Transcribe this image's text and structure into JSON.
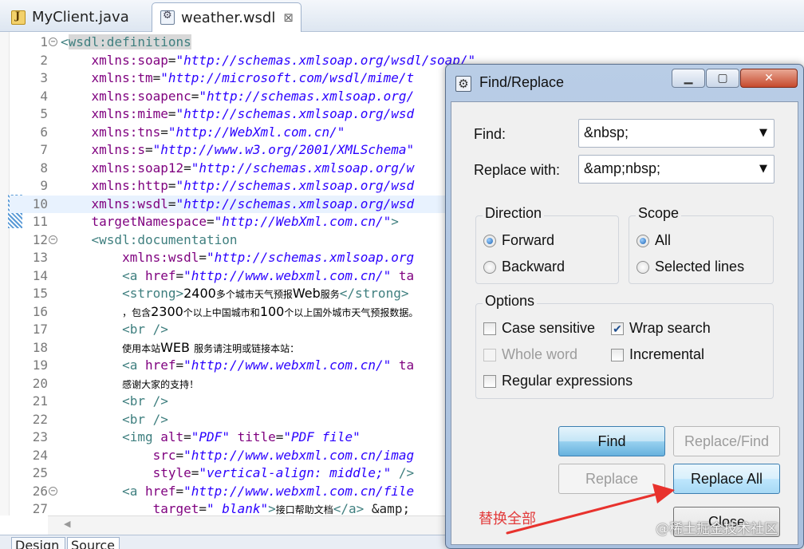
{
  "editor_tabs": [
    {
      "label": "MyClient.java",
      "icon": "java-file-icon"
    },
    {
      "label": "weather.wsdl",
      "icon": "wsdl-file-icon",
      "close": "⊠"
    }
  ],
  "code_lines": [
    {
      "n": "1",
      "fold": "⊖",
      "parts": [
        {
          "c": "tag",
          "t": "<"
        },
        {
          "c": "tag hl",
          "t": "wsdl:definitions"
        }
      ]
    },
    {
      "n": "2",
      "parts": [
        {
          "c": "plain",
          "t": "    "
        },
        {
          "c": "attr",
          "t": "xmlns:soap"
        },
        {
          "c": "plain",
          "t": "="
        },
        {
          "c": "val",
          "t": "\"http://schemas.xmlsoap.org/wsdl/soap/\""
        }
      ]
    },
    {
      "n": "3",
      "parts": [
        {
          "c": "plain",
          "t": "    "
        },
        {
          "c": "attr",
          "t": "xmlns:tm"
        },
        {
          "c": "plain",
          "t": "="
        },
        {
          "c": "val",
          "t": "\"http://microsoft.com/wsdl/mime/t"
        }
      ]
    },
    {
      "n": "4",
      "parts": [
        {
          "c": "plain",
          "t": "    "
        },
        {
          "c": "attr",
          "t": "xmlns:soapenc"
        },
        {
          "c": "plain",
          "t": "="
        },
        {
          "c": "val",
          "t": "\"http://schemas.xmlsoap.org/"
        }
      ]
    },
    {
      "n": "5",
      "parts": [
        {
          "c": "plain",
          "t": "    "
        },
        {
          "c": "attr",
          "t": "xmlns:mime"
        },
        {
          "c": "plain",
          "t": "="
        },
        {
          "c": "val",
          "t": "\"http://schemas.xmlsoap.org/wsd"
        }
      ]
    },
    {
      "n": "6",
      "parts": [
        {
          "c": "plain",
          "t": "    "
        },
        {
          "c": "attr",
          "t": "xmlns:tns"
        },
        {
          "c": "plain",
          "t": "="
        },
        {
          "c": "val",
          "t": "\"http://WebXml.com.cn/\""
        }
      ]
    },
    {
      "n": "7",
      "parts": [
        {
          "c": "plain",
          "t": "    "
        },
        {
          "c": "attr",
          "t": "xmlns:s"
        },
        {
          "c": "plain",
          "t": "="
        },
        {
          "c": "val",
          "t": "\"http://www.w3.org/2001/XMLSchema\""
        }
      ]
    },
    {
      "n": "8",
      "parts": [
        {
          "c": "plain",
          "t": "    "
        },
        {
          "c": "attr",
          "t": "xmlns:soap12"
        },
        {
          "c": "plain",
          "t": "="
        },
        {
          "c": "val",
          "t": "\"http://schemas.xmlsoap.org/w"
        }
      ]
    },
    {
      "n": "9",
      "parts": [
        {
          "c": "plain",
          "t": "    "
        },
        {
          "c": "attr",
          "t": "xmlns:http"
        },
        {
          "c": "plain",
          "t": "="
        },
        {
          "c": "val",
          "t": "\"http://schemas.xmlsoap.org/wsd"
        }
      ]
    },
    {
      "n": "10",
      "highlight": true,
      "parts": [
        {
          "c": "plain",
          "t": "    "
        },
        {
          "c": "attr",
          "t": "xmlns:wsdl"
        },
        {
          "c": "plain",
          "t": "="
        },
        {
          "c": "val",
          "t": "\"http://schemas.xmlsoap.org/wsd"
        }
      ]
    },
    {
      "n": "11",
      "parts": [
        {
          "c": "plain",
          "t": "    "
        },
        {
          "c": "attr",
          "t": "targetNamespace"
        },
        {
          "c": "plain",
          "t": "="
        },
        {
          "c": "val",
          "t": "\"http://WebXml.com.cn/\""
        },
        {
          "c": "tag",
          "t": ">"
        }
      ]
    },
    {
      "n": "12",
      "fold": "⊖",
      "parts": [
        {
          "c": "plain",
          "t": "    "
        },
        {
          "c": "tag",
          "t": "<wsdl:documentation"
        }
      ]
    },
    {
      "n": "13",
      "parts": [
        {
          "c": "plain",
          "t": "        "
        },
        {
          "c": "attr",
          "t": "xmlns:wsdl"
        },
        {
          "c": "plain",
          "t": "="
        },
        {
          "c": "val",
          "t": "\"http://schemas.xmlsoap.org"
        }
      ]
    },
    {
      "n": "14",
      "parts": [
        {
          "c": "plain",
          "t": "        "
        },
        {
          "c": "tag",
          "t": "<a "
        },
        {
          "c": "attr",
          "t": "href"
        },
        {
          "c": "plain",
          "t": "="
        },
        {
          "c": "val",
          "t": "\"http://www.webxml.com.cn/\""
        },
        {
          "c": "plain",
          "t": " "
        },
        {
          "c": "attr",
          "t": "ta"
        }
      ]
    },
    {
      "n": "15",
      "parts": [
        {
          "c": "plain",
          "t": "        "
        },
        {
          "c": "tag",
          "t": "<strong>"
        },
        {
          "c": "txt",
          "t": "2400"
        },
        {
          "c": "txt small",
          "t": "多个城市天气预报"
        },
        {
          "c": "txt",
          "t": "Web"
        },
        {
          "c": "txt small",
          "t": "服务"
        },
        {
          "c": "tag",
          "t": "</strong>"
        }
      ]
    },
    {
      "n": "16",
      "parts": [
        {
          "c": "plain",
          "t": "        "
        },
        {
          "c": "txt small",
          "t": "，包含"
        },
        {
          "c": "txt",
          "t": "2300"
        },
        {
          "c": "txt small",
          "t": "个以上中国城市和"
        },
        {
          "c": "txt",
          "t": "100"
        },
        {
          "c": "txt small",
          "t": "个以上国外城市天气预报数据。"
        }
      ]
    },
    {
      "n": "17",
      "parts": [
        {
          "c": "plain",
          "t": "        "
        },
        {
          "c": "tag",
          "t": "<br />"
        }
      ]
    },
    {
      "n": "18",
      "parts": [
        {
          "c": "plain",
          "t": "        "
        },
        {
          "c": "txt small",
          "t": "使用本站"
        },
        {
          "c": "txt",
          "t": "WEB "
        },
        {
          "c": "txt small",
          "t": "服务请注明或链接本站："
        }
      ]
    },
    {
      "n": "19",
      "parts": [
        {
          "c": "plain",
          "t": "        "
        },
        {
          "c": "tag",
          "t": "<a "
        },
        {
          "c": "attr",
          "t": "href"
        },
        {
          "c": "plain",
          "t": "="
        },
        {
          "c": "val",
          "t": "\"http://www.webxml.com.cn/\""
        },
        {
          "c": "plain",
          "t": " "
        },
        {
          "c": "attr",
          "t": "ta"
        }
      ]
    },
    {
      "n": "20",
      "parts": [
        {
          "c": "plain",
          "t": "        "
        },
        {
          "c": "txt small",
          "t": "感谢大家的支持！"
        }
      ]
    },
    {
      "n": "21",
      "parts": [
        {
          "c": "plain",
          "t": "        "
        },
        {
          "c": "tag",
          "t": "<br />"
        }
      ]
    },
    {
      "n": "22",
      "parts": [
        {
          "c": "plain",
          "t": "        "
        },
        {
          "c": "tag",
          "t": "<br />"
        }
      ]
    },
    {
      "n": "23",
      "parts": [
        {
          "c": "plain",
          "t": "        "
        },
        {
          "c": "tag",
          "t": "<img "
        },
        {
          "c": "attr",
          "t": "alt"
        },
        {
          "c": "plain",
          "t": "="
        },
        {
          "c": "val",
          "t": "\"PDF\""
        },
        {
          "c": "plain",
          "t": " "
        },
        {
          "c": "attr",
          "t": "title"
        },
        {
          "c": "plain",
          "t": "="
        },
        {
          "c": "val",
          "t": "\"PDF file\""
        }
      ]
    },
    {
      "n": "24",
      "parts": [
        {
          "c": "plain",
          "t": "            "
        },
        {
          "c": "attr",
          "t": "src"
        },
        {
          "c": "plain",
          "t": "="
        },
        {
          "c": "val",
          "t": "\"http://www.webxml.com.cn/imag"
        }
      ]
    },
    {
      "n": "25",
      "parts": [
        {
          "c": "plain",
          "t": "            "
        },
        {
          "c": "attr",
          "t": "style"
        },
        {
          "c": "plain",
          "t": "="
        },
        {
          "c": "val",
          "t": "\"vertical-align: middle;\""
        },
        {
          "c": "plain",
          "t": " "
        },
        {
          "c": "tag",
          "t": "/>"
        }
      ]
    },
    {
      "n": "26",
      "fold": "⊖",
      "parts": [
        {
          "c": "plain",
          "t": "        "
        },
        {
          "c": "tag",
          "t": "<a "
        },
        {
          "c": "attr",
          "t": "href"
        },
        {
          "c": "plain",
          "t": "="
        },
        {
          "c": "val",
          "t": "\"http://www.webxml.com.cn/file"
        }
      ]
    },
    {
      "n": "27",
      "parts": [
        {
          "c": "plain",
          "t": "            "
        },
        {
          "c": "attr",
          "t": "target"
        },
        {
          "c": "plain",
          "t": "="
        },
        {
          "c": "val",
          "t": "\"_blank\""
        },
        {
          "c": "tag",
          "t": ">"
        },
        {
          "c": "txt small",
          "t": "接口帮助文档"
        },
        {
          "c": "tag",
          "t": "</a>"
        },
        {
          "c": "plain",
          "t": " &amp;"
        }
      ]
    }
  ],
  "bottom_tabs": [
    "Design",
    "Source"
  ],
  "dialog": {
    "title": "Find/Replace",
    "window_buttons": {
      "minimize": "▁",
      "maximize": "▢",
      "close": "✕"
    },
    "find_label": "Find:",
    "find_value": "&nbsp;",
    "replace_label": "Replace with:",
    "replace_value": "&amp;nbsp;",
    "dropdown_glyph": "▼",
    "direction": {
      "title": "Direction",
      "options": [
        "Forward",
        "Backward"
      ],
      "selected": "Forward"
    },
    "scope": {
      "title": "Scope",
      "options": [
        "All",
        "Selected lines"
      ],
      "selected": "All"
    },
    "options": {
      "title": "Options",
      "case_sensitive": {
        "label": "Case sensitive",
        "checked": false,
        "enabled": true
      },
      "wrap_search": {
        "label": "Wrap search",
        "checked": true,
        "enabled": true
      },
      "whole_word": {
        "label": "Whole word",
        "checked": false,
        "enabled": false
      },
      "incremental": {
        "label": "Incremental",
        "checked": false,
        "enabled": true
      },
      "regex": {
        "label": "Regular expressions",
        "checked": false,
        "enabled": true
      }
    },
    "buttons": {
      "find": "Find",
      "replace_find": "Replace/Find",
      "replace": "Replace",
      "replace_all": "Replace All",
      "close": "Close"
    }
  },
  "annotation": {
    "text": "替换全部",
    "color": "#e23b3b"
  },
  "watermark": "@稀土掘金技术社区",
  "colors": {
    "tag": "#3f7f7f",
    "attribute": "#7f007f",
    "value": "#2a00ff",
    "line_highlight": "#e8f2fe",
    "dialog_frame": "#b9cde6"
  }
}
